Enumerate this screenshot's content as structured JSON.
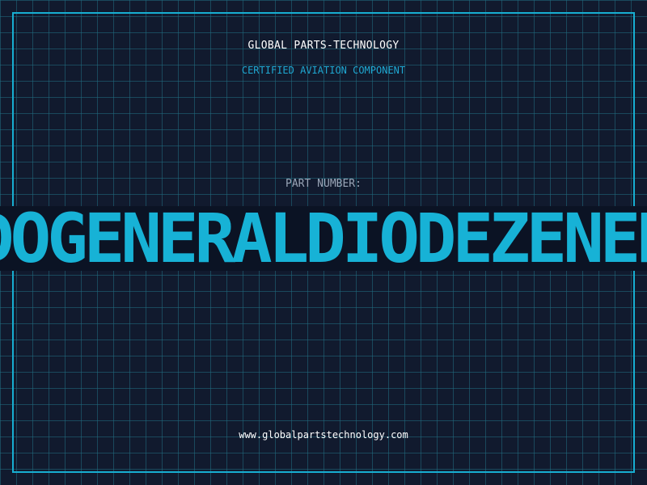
{
  "header": {
    "company": "GLOBAL PARTS-TECHNOLOGY",
    "tagline": "CERTIFIED AVIATION COMPONENT"
  },
  "part": {
    "label": "PART NUMBER:",
    "value": "DOGENERALDIODEZENER"
  },
  "footer": {
    "url": "www.globalpartstechnology.com"
  },
  "colors": {
    "background": "#111a2e",
    "accent": "#17b2d6",
    "text": "#ffffff",
    "muted": "#9aa6b8"
  }
}
